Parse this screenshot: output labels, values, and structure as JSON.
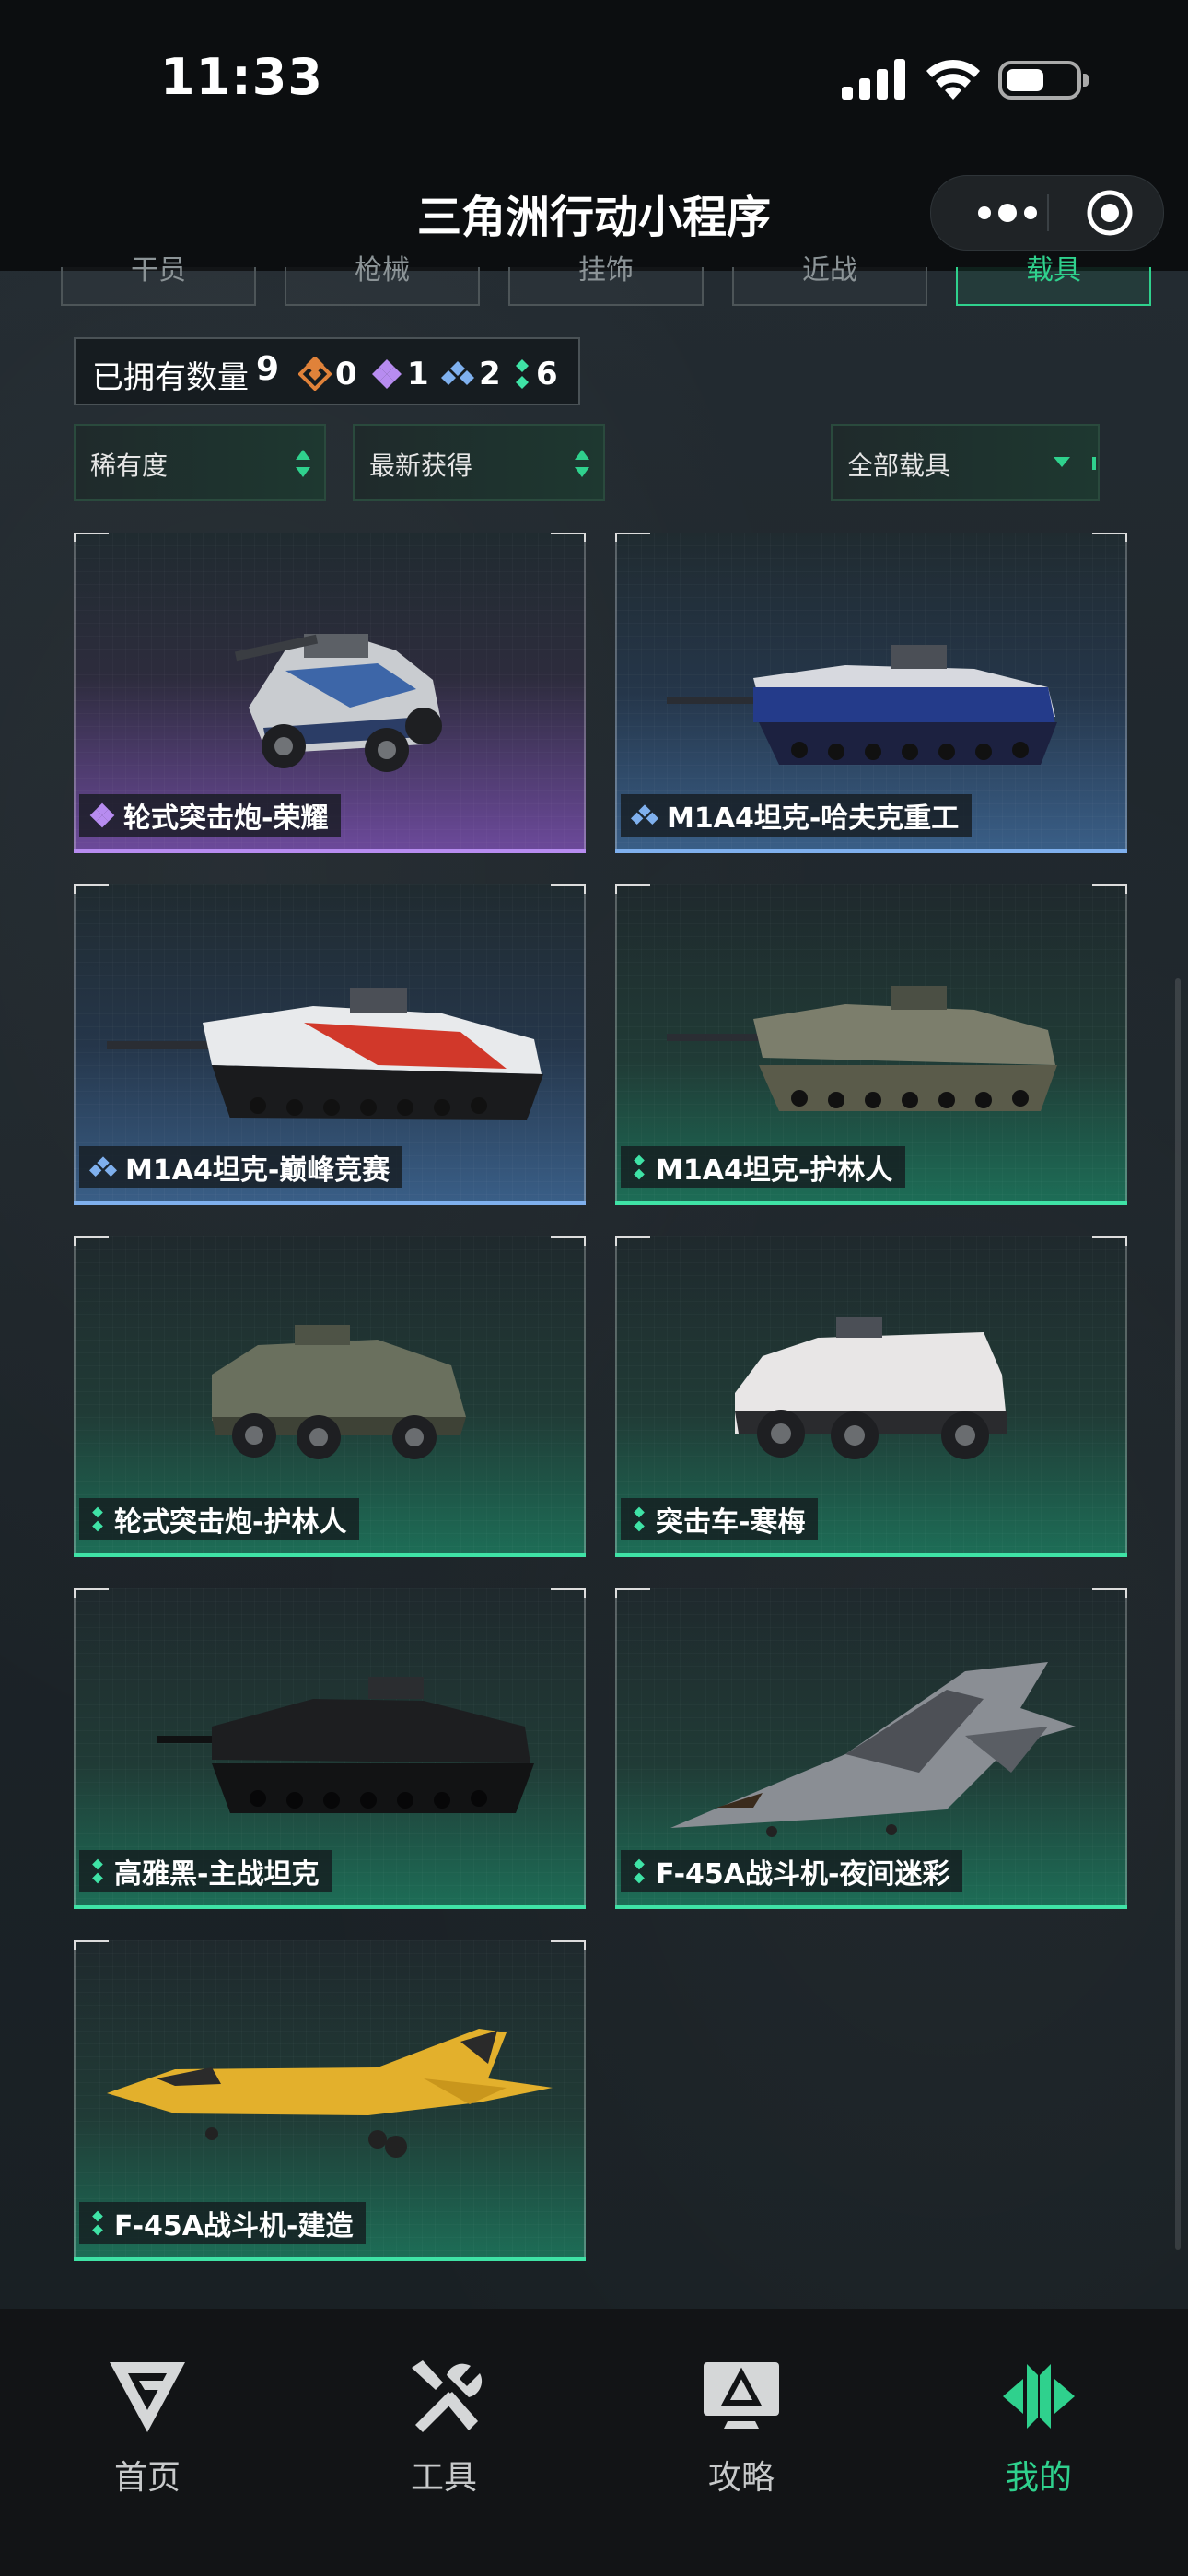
{
  "status_bar": {
    "time": "11:33"
  },
  "nav": {
    "title": "三角洲行动小程序"
  },
  "tabs": [
    {
      "label": "干员"
    },
    {
      "label": "枪械"
    },
    {
      "label": "挂饰"
    },
    {
      "label": "近战"
    },
    {
      "label": "载具",
      "active": true
    }
  ],
  "owned": {
    "label": "已拥有数量",
    "total": "9",
    "rarity_counts": [
      {
        "icon": "orange-diamond-icon",
        "color": "#e0823a",
        "count": "0"
      },
      {
        "icon": "purple-diamond-icon",
        "color": "#b78cf0",
        "count": "1"
      },
      {
        "icon": "blue-diamond-icon",
        "color": "#7fb0ee",
        "count": "2"
      },
      {
        "icon": "green-diamond-icon",
        "color": "#3fe3a6",
        "count": "6"
      }
    ]
  },
  "filters": {
    "rarity": "稀有度",
    "sort": "最新获得",
    "category": "全部载具"
  },
  "items": [
    {
      "name": "轮式突击炮-荣耀",
      "rarity": "purple",
      "vehicle": "wheeled-assault-gun"
    },
    {
      "name": "M1A4坦克-哈夫克重工",
      "rarity": "blue",
      "vehicle": "tank"
    },
    {
      "name": "M1A4坦克-巅峰竞赛",
      "rarity": "blue",
      "vehicle": "tank"
    },
    {
      "name": "M1A4坦克-护林人",
      "rarity": "green",
      "vehicle": "tank"
    },
    {
      "name": "轮式突击炮-护林人",
      "rarity": "green",
      "vehicle": "wheeled-assault-gun"
    },
    {
      "name": "突击车-寒梅",
      "rarity": "green",
      "vehicle": "assault-vehicle"
    },
    {
      "name": "高雅黑-主战坦克",
      "rarity": "green",
      "vehicle": "tank"
    },
    {
      "name": "F-45A战斗机-夜间迷彩",
      "rarity": "green",
      "vehicle": "fighter-jet"
    },
    {
      "name": "F-45A战斗机-建造",
      "rarity": "green",
      "vehicle": "fighter-jet"
    }
  ],
  "bottom_nav": [
    {
      "label": "首页",
      "icon": "home-logo-icon"
    },
    {
      "label": "工具",
      "icon": "tools-icon"
    },
    {
      "label": "攻略",
      "icon": "guide-monitor-icon"
    },
    {
      "label": "我的",
      "icon": "profile-logo-icon",
      "active": true
    }
  ],
  "colors": {
    "accent": "#2fd18d",
    "purple": "#b78cf0",
    "blue": "#7fb0ee",
    "green": "#3fe3a6"
  }
}
